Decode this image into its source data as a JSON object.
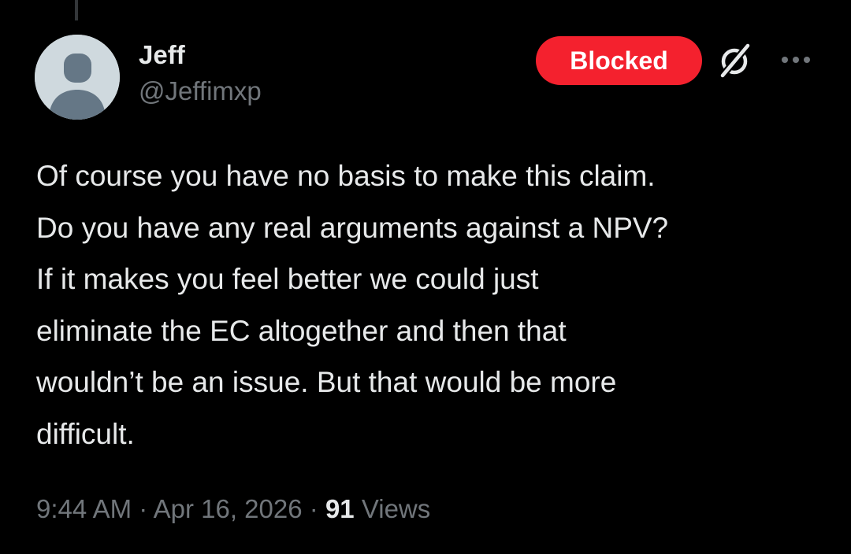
{
  "tweet": {
    "author": {
      "display_name": "Jeff",
      "handle": "@Jeffimxp"
    },
    "follow_status_label": "Blocked",
    "text": "Of course you have no basis to make this claim.\nDo you have any real arguments against a NPV?\nIf it makes you feel better we could just\neliminate the EC altogether and then that\nwouldn’t be an issue. But that would be more\ndifficult.",
    "time": "9:44 AM",
    "separator": "·",
    "date": "Apr 16, 2026",
    "views_count": "91",
    "views_label": "Views"
  },
  "icons": {
    "avatar": "default-avatar-silhouette",
    "grok": "grok-icon",
    "more": "more-dots-icon"
  },
  "colors": {
    "background": "#000000",
    "primary_text": "#e7e9ea",
    "secondary_text": "#71767b",
    "blocked_red": "#f4212e",
    "avatar_bg": "#cfd9de",
    "avatar_figure": "#657786"
  }
}
